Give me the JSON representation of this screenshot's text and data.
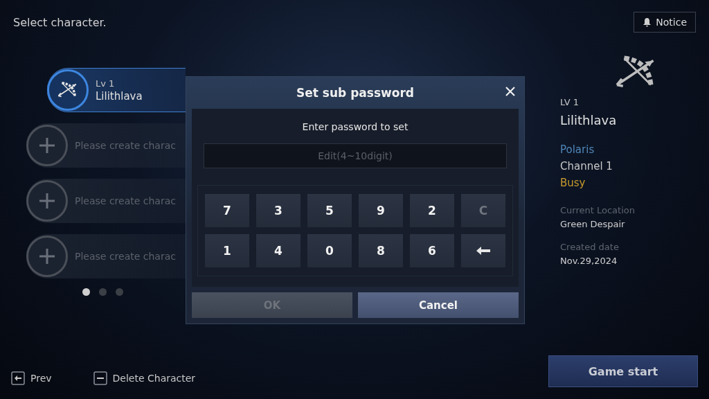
{
  "header": {
    "title": "Select character.",
    "notice_button": "Notice"
  },
  "slots": [
    {
      "kind": "character",
      "selected": true,
      "level": "Lv 1",
      "name": "Lilithlava"
    },
    {
      "kind": "empty",
      "selected": false,
      "label": "Please create charac"
    },
    {
      "kind": "empty",
      "selected": false,
      "label": "Please create charac"
    },
    {
      "kind": "empty",
      "selected": false,
      "label": "Please create charac"
    }
  ],
  "pages": [
    {
      "selected": true
    },
    {
      "selected": false
    },
    {
      "selected": false
    }
  ],
  "details": {
    "level": "LV 1",
    "name": "Lilithlava",
    "status_lines": [
      {
        "text": "Polaris",
        "color": "#4f86b8"
      },
      {
        "text": "Channel 1",
        "color": "#c8c8c8"
      },
      {
        "text": "Busy",
        "color": "#c79a2c"
      }
    ],
    "fields": [
      {
        "label": "Current Location",
        "value": "Green Despair"
      },
      {
        "label": "Created date",
        "value": "Nov.29,2024"
      }
    ]
  },
  "dialog": {
    "title": "Set sub password",
    "prompt": "Enter password to set",
    "input": {
      "placeholder": "Edit(4~10digit)"
    },
    "keys": [
      {
        "kind": "digit",
        "label": "7",
        "disabled": false
      },
      {
        "kind": "digit",
        "label": "3",
        "disabled": false
      },
      {
        "kind": "digit",
        "label": "5",
        "disabled": false
      },
      {
        "kind": "digit",
        "label": "9",
        "disabled": false
      },
      {
        "kind": "digit",
        "label": "2",
        "disabled": false
      },
      {
        "kind": "clear",
        "label": "C",
        "disabled": true
      },
      {
        "kind": "digit",
        "label": "1",
        "disabled": false
      },
      {
        "kind": "digit",
        "label": "4",
        "disabled": false
      },
      {
        "kind": "digit",
        "label": "0",
        "disabled": false
      },
      {
        "kind": "digit",
        "label": "8",
        "disabled": false
      },
      {
        "kind": "digit",
        "label": "6",
        "disabled": false
      },
      {
        "kind": "backspace",
        "disabled": false
      }
    ],
    "buttons": [
      {
        "label": "OK",
        "disabled": true
      },
      {
        "label": "Cancel",
        "disabled": false
      }
    ]
  },
  "footer": {
    "prev": "Prev",
    "delete": "Delete Character",
    "start": "Game start"
  }
}
